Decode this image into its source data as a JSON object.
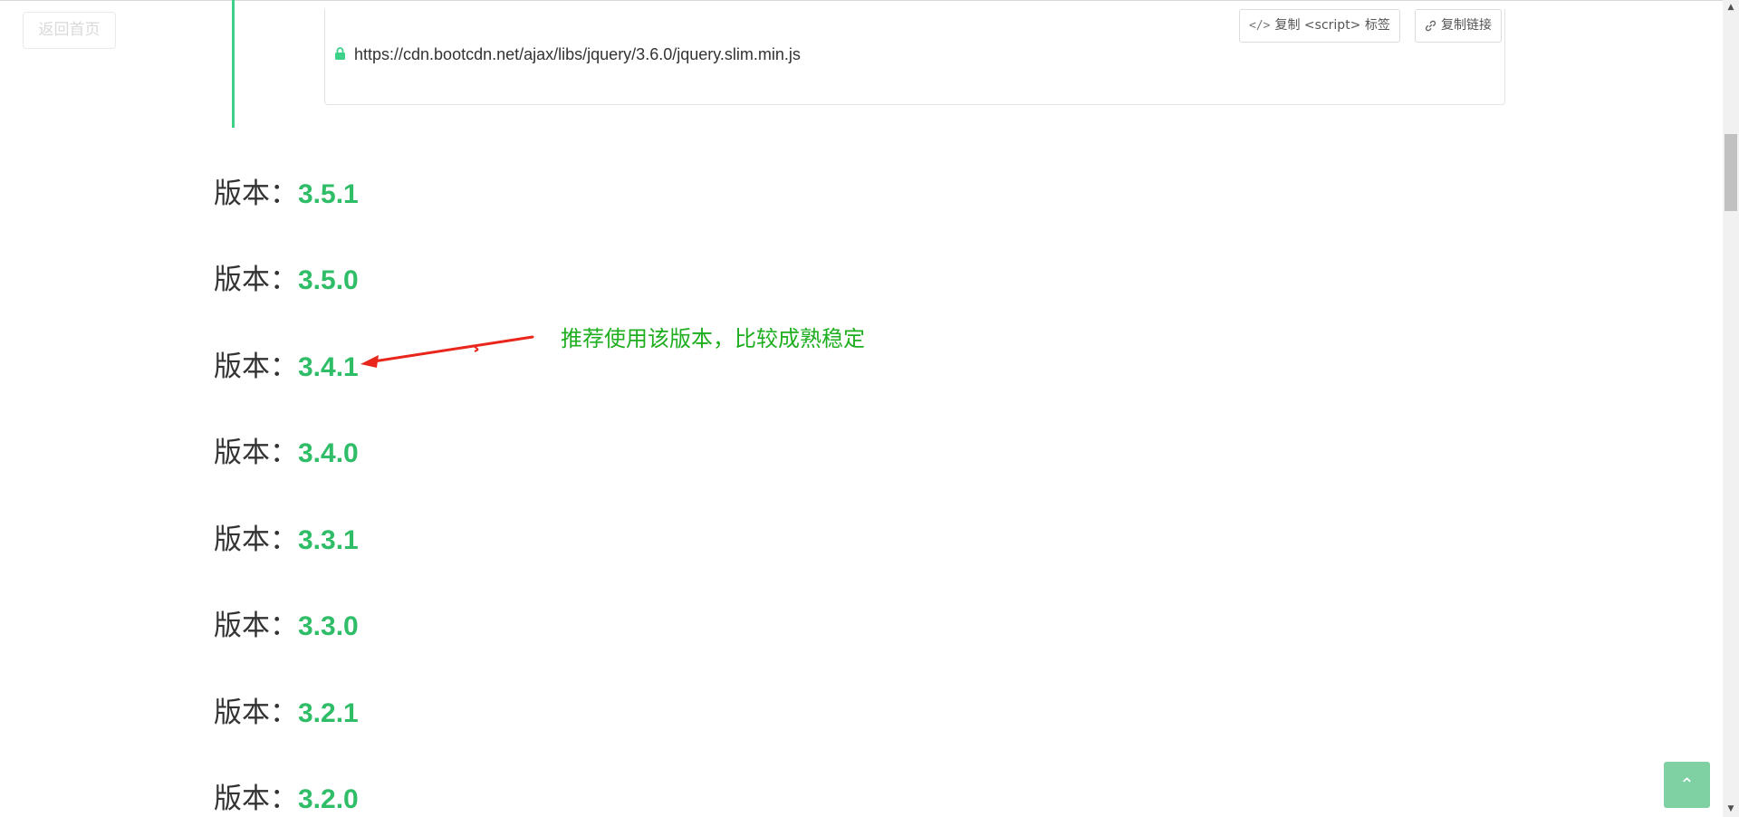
{
  "nav": {
    "back_home_label": "返回首页"
  },
  "cdn_card": {
    "url": "https://cdn.bootcdn.net/ajax/libs/jquery/3.6.0/jquery.slim.min.js",
    "copy_script_icon": "</>",
    "copy_script_label": "复制 <script> 标签",
    "copy_link_icon": "link-icon",
    "copy_link_label": "复制链接"
  },
  "versions": [
    {
      "label": "版本：",
      "version": "3.5.1"
    },
    {
      "label": "版本：",
      "version": "3.5.0"
    },
    {
      "label": "版本：",
      "version": "3.4.1"
    },
    {
      "label": "版本：",
      "version": "3.4.0"
    },
    {
      "label": "版本：",
      "version": "3.3.1"
    },
    {
      "label": "版本：",
      "version": "3.3.0"
    },
    {
      "label": "版本：",
      "version": "3.2.1"
    },
    {
      "label": "版本：",
      "version": "3.2.0"
    }
  ],
  "annotation": {
    "text": "推荐使用该版本，比较成熟稳定",
    "color": "#1fae1f",
    "arrow_color": "#e8261c"
  },
  "colors": {
    "accent_green": "#2fbd68",
    "rail_green": "#3ed18a",
    "to_top_bg": "#7fd1a3"
  },
  "scroll_to_top": {
    "icon": "chevron-up-icon",
    "glyph": "⌃"
  },
  "scrollbar": {
    "up_glyph": "▲",
    "down_glyph": "▼"
  }
}
